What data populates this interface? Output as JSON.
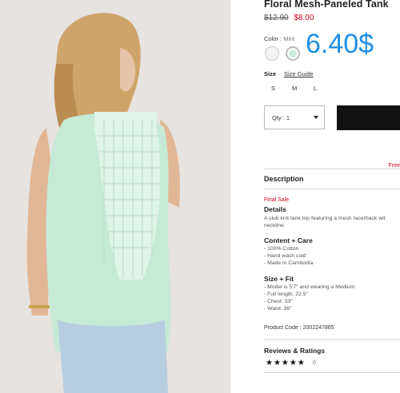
{
  "product": {
    "title": "Floral Mesh-Paneled Tank",
    "old_price": "$12.90",
    "sale_price": "$8.00",
    "overlay_price": "6.40$"
  },
  "color": {
    "label": "Color",
    "value": "Mint",
    "swatches": [
      {
        "name": "white",
        "hex": "#f5f3f6"
      },
      {
        "name": "mint",
        "hex": "#cdeedc"
      }
    ]
  },
  "size": {
    "label": "Size",
    "guide_label": "Size Guide",
    "options": [
      "S",
      "M",
      "L"
    ]
  },
  "quantity": {
    "label": "Qty : 1"
  },
  "shipping_note": "Free",
  "description": {
    "title": "Description",
    "final_sale": "Final Sale",
    "details_heading": "Details",
    "details_line1": "A slub knit tank top featuring a mesh racerback wit",
    "details_line2": "neckline.",
    "content_heading": "Content + Care",
    "content_lines": [
      "- 100% Cotton",
      "- Hand wash cold",
      "- Made in Cambodia"
    ],
    "fit_heading": "Size + Fit",
    "fit_lines": [
      "- Model is 5'7\" and wearing a Medium",
      "- Full length: 22.5\"",
      "- Chest: 33\"",
      "- Waist: 36\""
    ],
    "product_code": "Product Code : 2002247865"
  },
  "reviews": {
    "title": "Reviews & Ratings",
    "stars": "★★★★★",
    "count": "0"
  },
  "colors": {
    "sale": "#d0021b",
    "overlay": "#1e8fe6",
    "button": "#111111"
  }
}
